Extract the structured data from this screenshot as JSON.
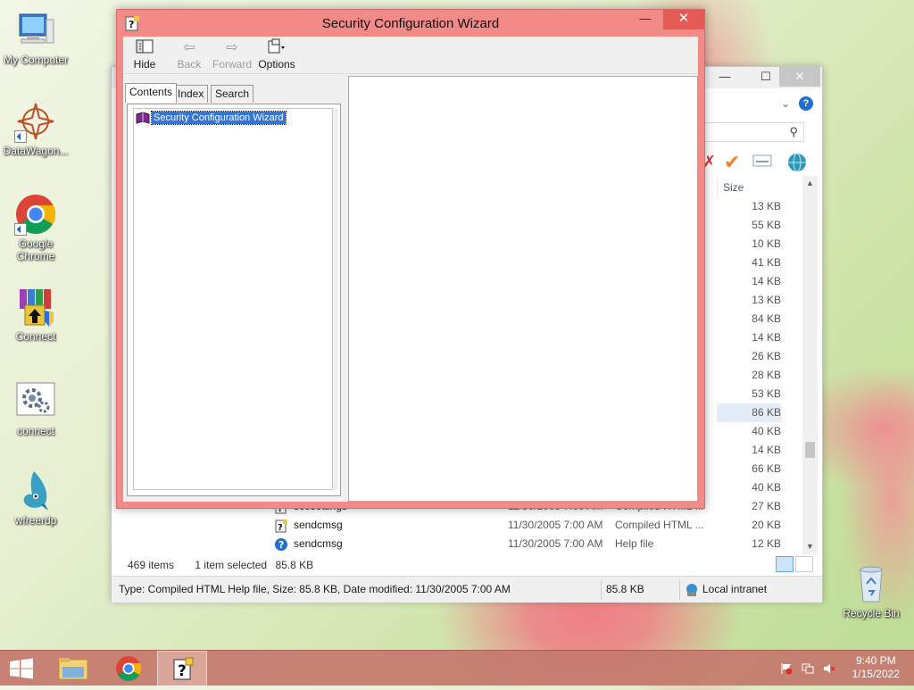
{
  "desktop": {
    "icons": [
      {
        "label": "My Computer"
      },
      {
        "label": "DataWagon..."
      },
      {
        "label": "Google Chrome"
      },
      {
        "label": "Connect"
      },
      {
        "label": "connect"
      },
      {
        "label": "wfreerdp"
      },
      {
        "label": "Recycle Bin"
      }
    ]
  },
  "help_window": {
    "title": "Security Configuration Wizard",
    "toolbar": {
      "hide": "Hide",
      "back": "Back",
      "forward": "Forward",
      "options": "Options"
    },
    "tabs": {
      "contents": "Contents",
      "index": "Index",
      "search": "Search"
    },
    "tree_item": "Security Configuration Wizard"
  },
  "explorer": {
    "size_header": "Size",
    "sizes": [
      "13 KB",
      "55 KB",
      "10 KB",
      "41 KB",
      "14 KB",
      "13 KB",
      "84 KB",
      "14 KB",
      "26 KB",
      "28 KB",
      "53 KB",
      "86 KB",
      "40 KB",
      "14 KB",
      "66 KB",
      "40 KB"
    ],
    "selected_size_index": 11,
    "rows": [
      {
        "name": "scesettings",
        "date": "11/30/2005 7:00 AM",
        "type": "Compiled HTML ...",
        "size": "27 KB",
        "icon": "chm-icon"
      },
      {
        "name": "sendcmsg",
        "date": "11/30/2005 7:00 AM",
        "type": "Compiled HTML ...",
        "size": "20 KB",
        "icon": "chm-icon"
      },
      {
        "name": "sendcmsg",
        "date": "11/30/2005 7:00 AM",
        "type": "Help file",
        "size": "12 KB",
        "icon": "help-icon"
      }
    ],
    "status": {
      "items": "469 items",
      "selected": "1 item selected",
      "size": "85.8 KB"
    },
    "statusbar": {
      "details": "Type: Compiled HTML Help file, Size: 85.8 KB, Date modified: 11/30/2005 7:00 AM",
      "size": "85.8 KB",
      "zone": "Local intranet"
    }
  },
  "taskbar": {
    "time": "9:40 PM",
    "date": "1/15/2022"
  },
  "colors": {
    "hh_frame": "#f28a88",
    "taskbar": "#c4786e",
    "selection": "#3375d7"
  }
}
